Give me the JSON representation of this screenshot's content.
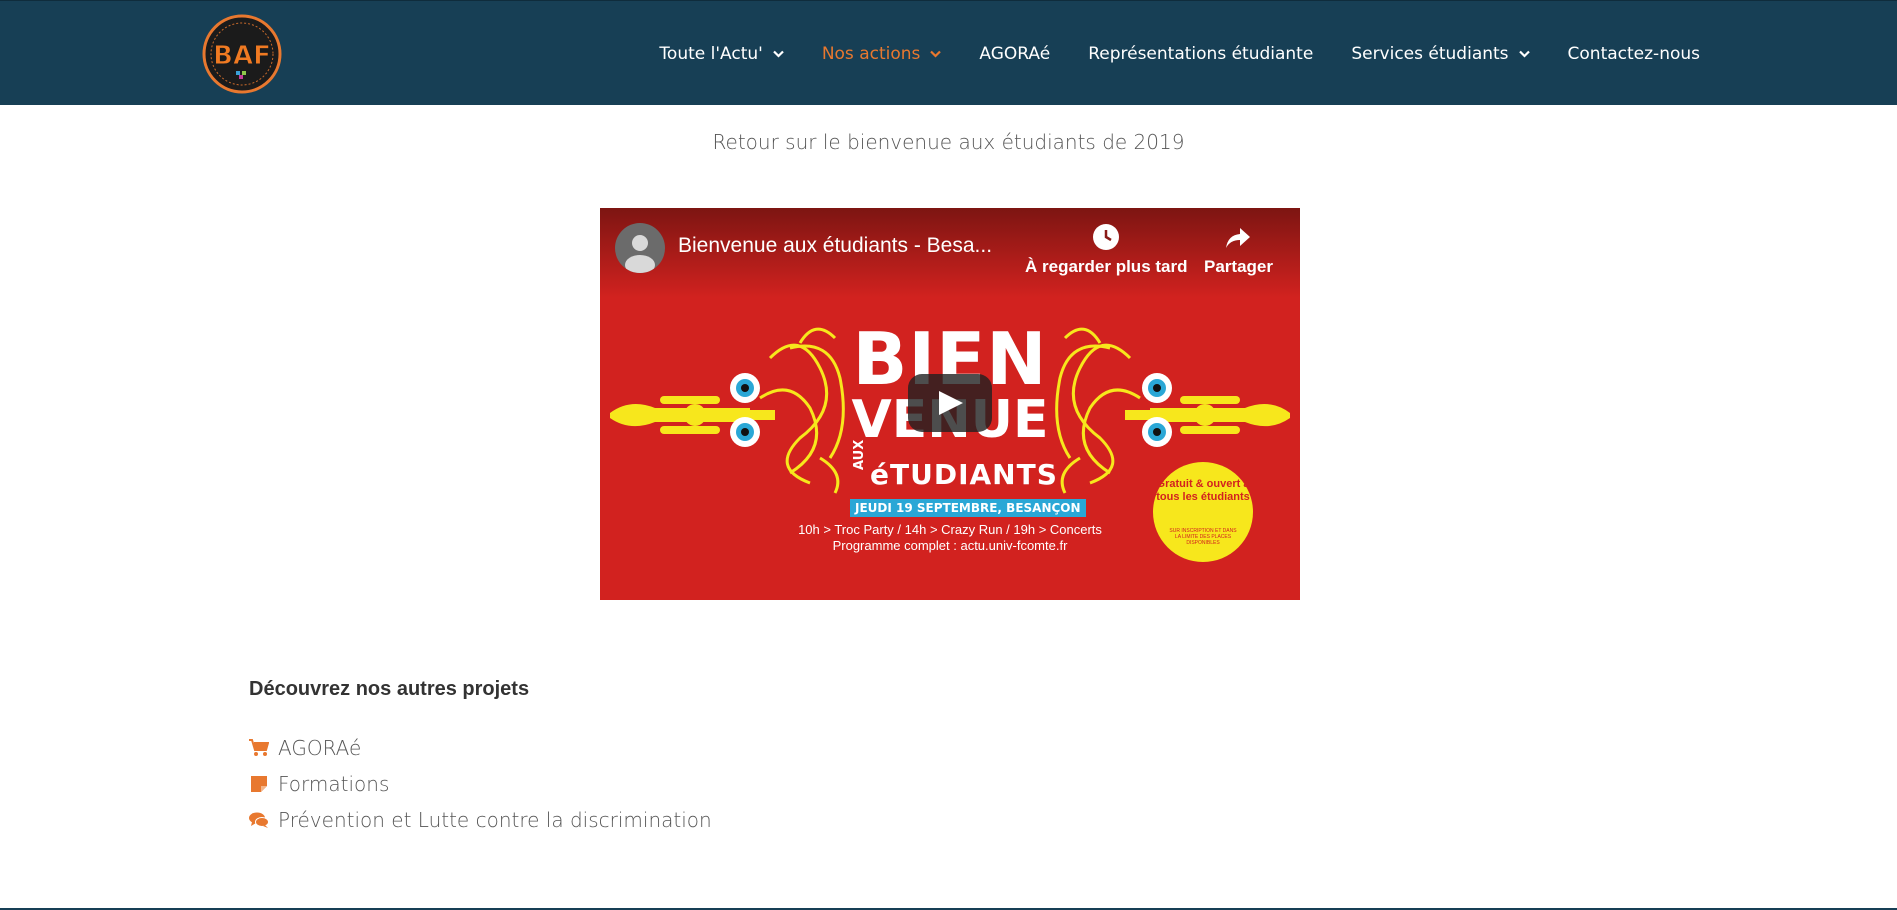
{
  "header": {
    "logo_text": "BAF",
    "nav": [
      {
        "label": "Toute l'Actu'",
        "has_dropdown": true,
        "active": false
      },
      {
        "label": "Nos actions",
        "has_dropdown": true,
        "active": true
      },
      {
        "label": "AGORAé",
        "has_dropdown": false,
        "active": false
      },
      {
        "label": "Représentations étudiante",
        "has_dropdown": false,
        "active": false
      },
      {
        "label": "Services étudiants",
        "has_dropdown": true,
        "active": false
      },
      {
        "label": "Contactez-nous",
        "has_dropdown": false,
        "active": false
      }
    ]
  },
  "main": {
    "subtitle": "Retour sur le bienvenue aux étudiants de 2019",
    "video": {
      "title": "Bienvenue aux étudiants - Besa...",
      "watch_later_label": "À regarder plus tard",
      "share_label": "Partager",
      "poster": {
        "line1": "BIEN",
        "line2": "VENUE",
        "aux": "AUX",
        "line3": "éTUDIANTS",
        "date": "JEUDI 19 SEPTEMBRE, BESANÇON",
        "schedule": "10h > Troc Party / 14h > Crazy Run / 19h > Concerts",
        "program": "Programme complet : actu.univ-fcomte.fr",
        "badge_main": "Gratuit & ouvert à tous les étudiants",
        "badge_small": "SUR INSCRIPTION ET DANS LA LIMITE DES PLACES DISPONIBLES"
      }
    },
    "projects": {
      "heading": "Découvrez nos autres projets",
      "items": [
        {
          "label": "AGORAé",
          "icon": "cart-icon"
        },
        {
          "label": "Formations",
          "icon": "sticky-note-icon"
        },
        {
          "label": "Prévention et Lutte contre la discrimination",
          "icon": "comments-icon"
        }
      ]
    }
  },
  "colors": {
    "header_bg": "#173f55",
    "accent": "#e8782f",
    "poster_red": "#d2221f",
    "poster_yellow": "#f7e71c",
    "poster_blue": "#2aa7d6"
  }
}
